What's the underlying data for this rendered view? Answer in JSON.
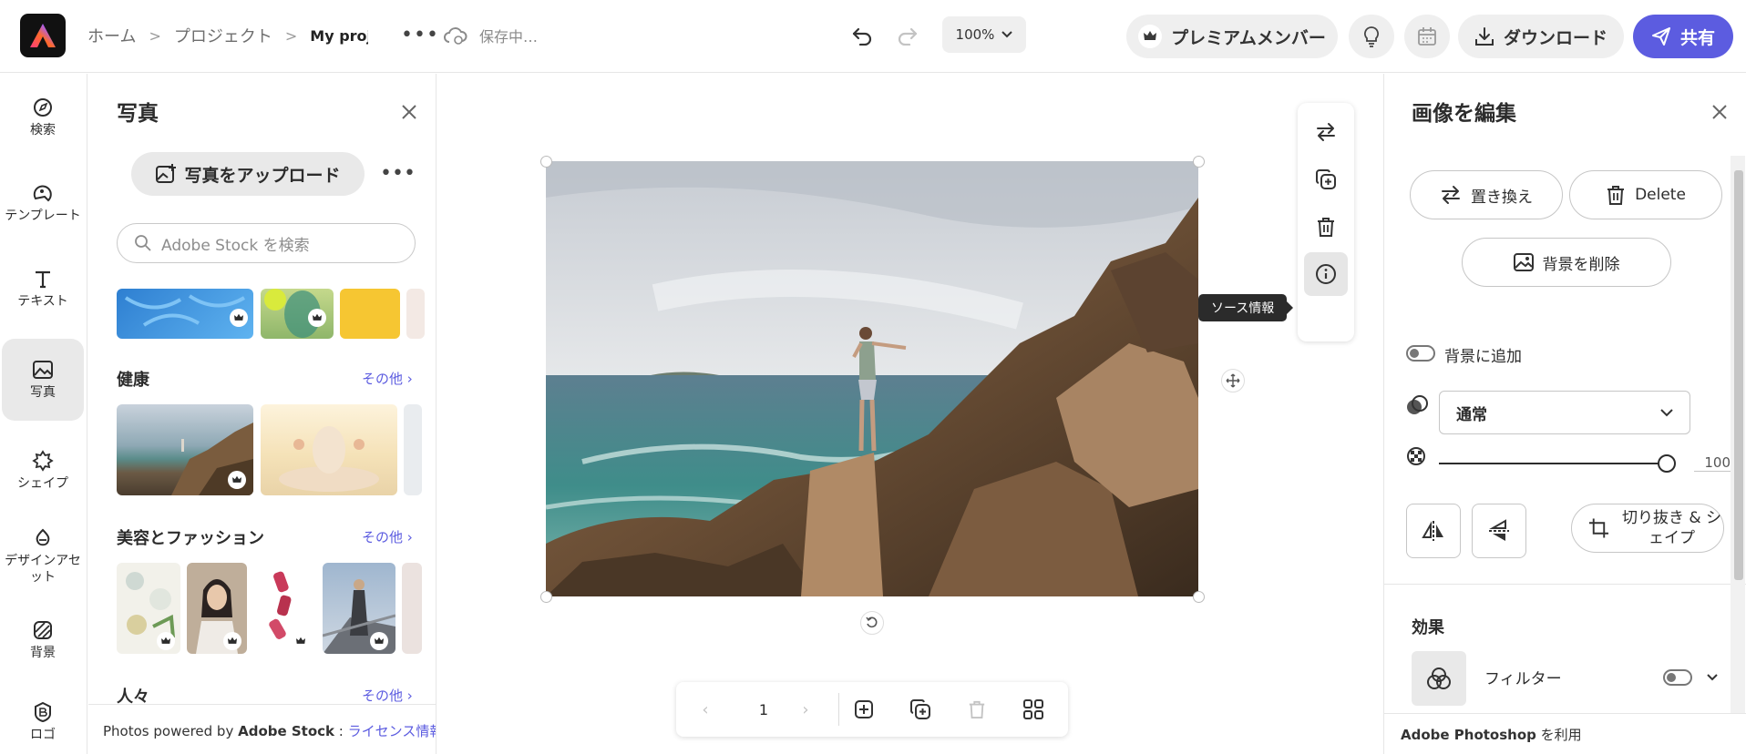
{
  "header": {
    "breadcrumb": [
      "ホーム",
      "プロジェクト",
      "My proje"
    ],
    "more_label": "•••",
    "save_status": "保存中…",
    "zoom": "100%",
    "premium_label": "プレミアムメンバー",
    "download_label": "ダウンロード",
    "share_label": "共有"
  },
  "rail": {
    "items": [
      {
        "label": "検索",
        "icon": "search-icon"
      },
      {
        "label": "テンプレート",
        "icon": "template-icon"
      },
      {
        "label": "テキスト",
        "icon": "text-icon"
      },
      {
        "label": "写真",
        "icon": "photo-icon",
        "active": true
      },
      {
        "label": "シェイプ",
        "icon": "shape-icon"
      },
      {
        "label": "デザインアセット",
        "icon": "design-asset-icon"
      },
      {
        "label": "背景",
        "icon": "background-icon"
      },
      {
        "label": "ロゴ",
        "icon": "logo-icon"
      }
    ]
  },
  "photo_panel": {
    "title": "写真",
    "upload_label": "写真をアップロード",
    "more_label": "•••",
    "search_placeholder": "Adobe Stock を検索",
    "categories": [
      {
        "title": "健康",
        "more": "その他 ›"
      },
      {
        "title": "美容とファッション",
        "more": "その他 ›"
      },
      {
        "title": "人々",
        "more": "その他 ›"
      }
    ],
    "footer_prefix": "Photos powered by ",
    "footer_brand": "Adobe Stock",
    "footer_sep": " : ",
    "footer_link": "ライセンス情報"
  },
  "canvas": {
    "tooltip": "ソース情報",
    "page_number": "1"
  },
  "edit_panel": {
    "title": "画像を編集",
    "replace_label": "置き換え",
    "delete_label": "Delete",
    "remove_bg_label": "背景を削除",
    "add_to_bg_label": "背景に追加",
    "blend_mode": "通常",
    "opacity_value": "100",
    "opacity_fraction": 1.0,
    "crop_label": "切り抜き & シェイプ",
    "effects_title": "効果",
    "filter_label": "フィルター",
    "footer_brand": "Adobe Photoshop",
    "footer_suffix": " を利用"
  },
  "colors": {
    "accent": "#5c5ce0",
    "tooltip_bg": "#2b2b2b",
    "chip_bg": "#efefef"
  }
}
